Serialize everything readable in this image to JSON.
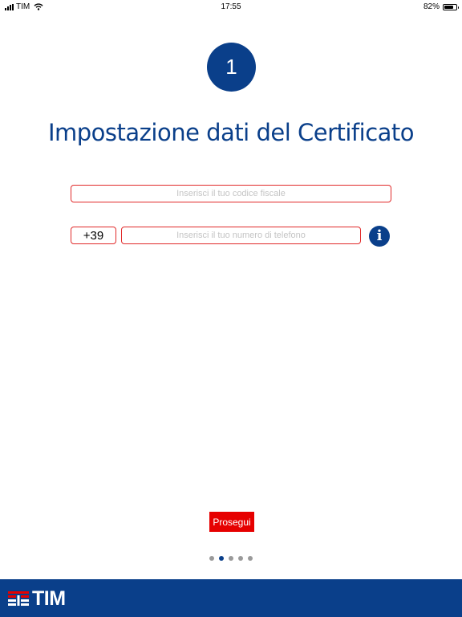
{
  "status_bar": {
    "carrier": "TIM",
    "time": "17:55",
    "battery_text": "82%",
    "battery_level": 0.82
  },
  "step": {
    "number": "1"
  },
  "page_title": "Impostazione dati del Certificato",
  "form": {
    "codice_fiscale": {
      "value": "",
      "placeholder": "Inserisci il tuo codice fiscale"
    },
    "phone_prefix": "+39",
    "phone": {
      "value": "",
      "placeholder": "Inserisci il tuo numero di telefono"
    }
  },
  "submit_label": "Prosegui",
  "pager": {
    "count": 5,
    "active_index": 1
  },
  "footer": {
    "logo_text": "TIM"
  },
  "colors": {
    "brand_blue": "#0a3f8a",
    "accent_red": "#e60000",
    "field_border": "#e12a2a"
  },
  "icons": [
    "signal-icon",
    "wifi-icon",
    "battery-icon",
    "info-icon",
    "tim-logo-icon"
  ]
}
